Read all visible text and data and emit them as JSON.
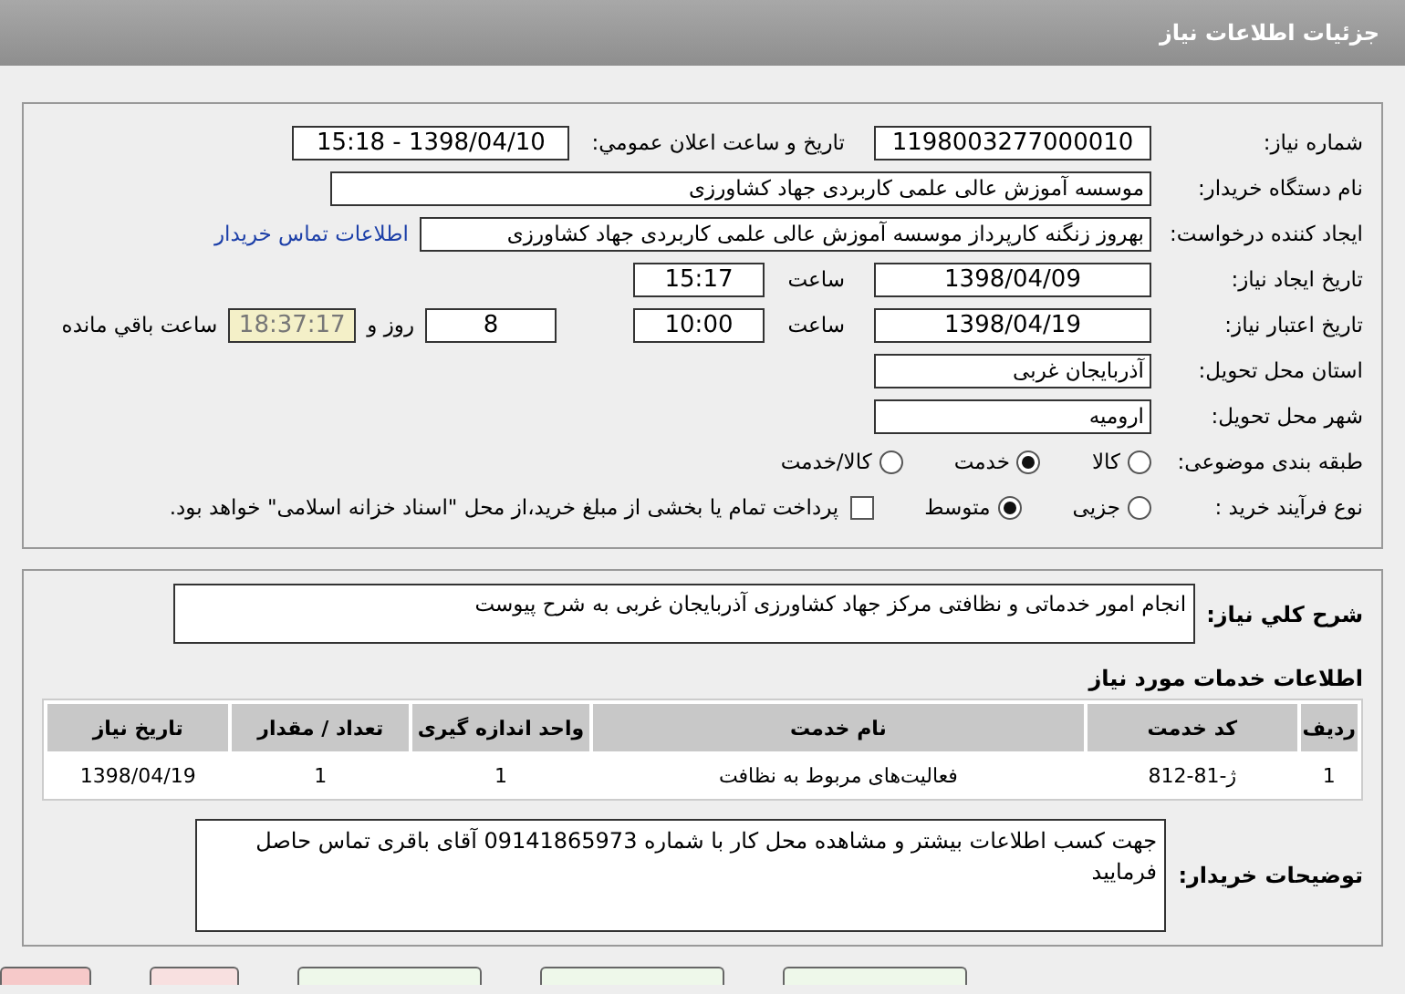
{
  "header": {
    "title": "جزئیات اطلاعات نیاز"
  },
  "need_number": {
    "label": "شماره نیاز:",
    "value": "1198003277000010"
  },
  "announce": {
    "label": "تاريخ و ساعت اعلان عمومي:",
    "value": "1398/04/10 - 15:18"
  },
  "buyer_org": {
    "label": "نام دستگاه خریدار:",
    "value": "موسسه آموزش عالی علمی کاربردی جهاد کشاورزی"
  },
  "requester": {
    "label": "ایجاد کننده درخواست:",
    "value": "بهروز زنگنه کارپرداز موسسه آموزش عالی علمی کاربردی جهاد کشاورزی",
    "link": "اطلاعات تماس خریدار"
  },
  "created": {
    "label": "تاریخ ایجاد نیاز:",
    "date": "1398/04/09",
    "time_label": "ساعت",
    "time": "15:17"
  },
  "validity": {
    "label": "تاریخ اعتبار نیاز:",
    "date": "1398/04/19",
    "time_label": "ساعت",
    "time": "10:00",
    "days": "8",
    "days_label": "روز و",
    "remaining": "18:37:17",
    "remaining_label": "ساعت باقي مانده"
  },
  "province": {
    "label": "استان محل تحویل:",
    "value": "آذربایجان غربی"
  },
  "city": {
    "label": "شهر محل تحویل:",
    "value": "ارومیه"
  },
  "category": {
    "label": "طبقه بندی موضوعی:",
    "options": [
      {
        "label": "کالا",
        "selected": false
      },
      {
        "label": "خدمت",
        "selected": true
      },
      {
        "label": "کالا/خدمت",
        "selected": false
      }
    ]
  },
  "process": {
    "label": "نوع فرآیند خرید :",
    "options": [
      {
        "label": "جزیی",
        "selected": false
      },
      {
        "label": "متوسط",
        "selected": true
      }
    ],
    "payment": {
      "label": "پرداخت تمام یا بخشی از مبلغ خرید،از محل \"اسناد خزانه اسلامی\" خواهد بود.",
      "checked": false
    }
  },
  "description": {
    "label": "شرح کلي نياز:",
    "value": "انجام امور خدماتی و نظافتی مرکز جهاد کشاورزی آذربایجان غربی به شرح پیوست"
  },
  "services": {
    "title": "اطلاعات خدمات مورد نیاز",
    "columns": [
      "ردیف",
      "کد خدمت",
      "نام خدمت",
      "واحد اندازه گیری",
      "تعداد / مقدار",
      "تاریخ نیاز"
    ],
    "rows": [
      [
        "1",
        "ژ-81-812",
        "فعالیت‌های مربوط به نظافت",
        "1",
        "1",
        "1398/04/19"
      ]
    ]
  },
  "buyer_notes": {
    "label": "توضیحات خریدار:",
    "value": "جهت کسب اطلاعات بیشتر و مشاهده محل کار با شماره 09141865973 آقای باقری تماس حاصل فرمایید"
  },
  "bottom_buttons": [
    {
      "kind": "normal"
    },
    {
      "kind": "normal"
    },
    {
      "kind": "normal"
    },
    {
      "kind": "warning"
    },
    {
      "kind": "danger"
    }
  ]
}
